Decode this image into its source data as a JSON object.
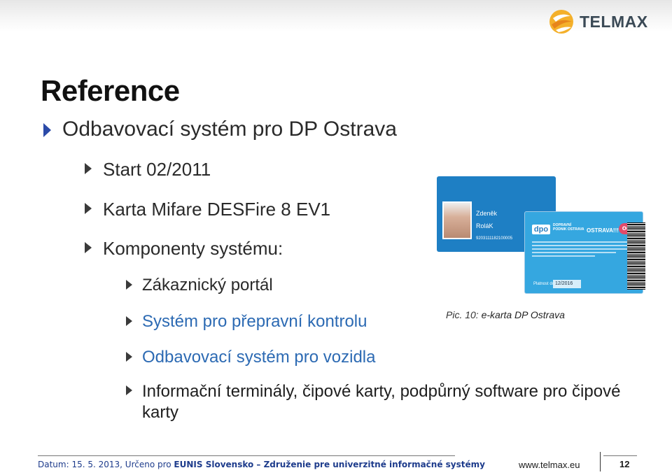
{
  "brand": {
    "name": "TELMAX",
    "color": "#3b4a56",
    "accent": "#f29a1c"
  },
  "title": "Reference",
  "bullets": {
    "level1": "Odbavovací systém pro DP Ostrava",
    "level2": [
      "Start 02/2011",
      "Karta Mifare DESFire 8 EV1",
      "Komponenty systému:"
    ],
    "level3": [
      {
        "text": "Zákaznický portál",
        "link": false
      },
      {
        "text": "Systém pro přepravní kontrolu",
        "link": true
      },
      {
        "text": "Odbavovací systém pro vozidla",
        "link": true
      },
      {
        "text": "Informační terminály, čipové karty, podpůrný software pro čipové karty",
        "link": false
      }
    ]
  },
  "image": {
    "caption_prefix": "Pic. 10:",
    "caption_text": "e-karta DP Ostrava",
    "card_back": {
      "first_name": "Zdeněk",
      "last_name": "RoláK",
      "number": "9203111182100005"
    },
    "card_front": {
      "logo": "dpo",
      "brand": "DOPRAVNÍ PODNIK OSTRAVA",
      "city": "OSTRAVA!!!",
      "partner": "odis",
      "valid_label": "Platnost do:",
      "valid": "12/2016"
    }
  },
  "footer": {
    "date_text": "Datum: 15. 5. 2013, Určeno pro ",
    "eunis": "EUNIS Slovensko – Združenie pre univerzitné informačné systémy",
    "url": "www.telmax.eu",
    "page": "12"
  },
  "colors": {
    "link": "#2c6ab3",
    "arrow_l1": "#2b4aa8",
    "footer": "#1e3c8c",
    "card_blue": "#1e7fc4"
  }
}
